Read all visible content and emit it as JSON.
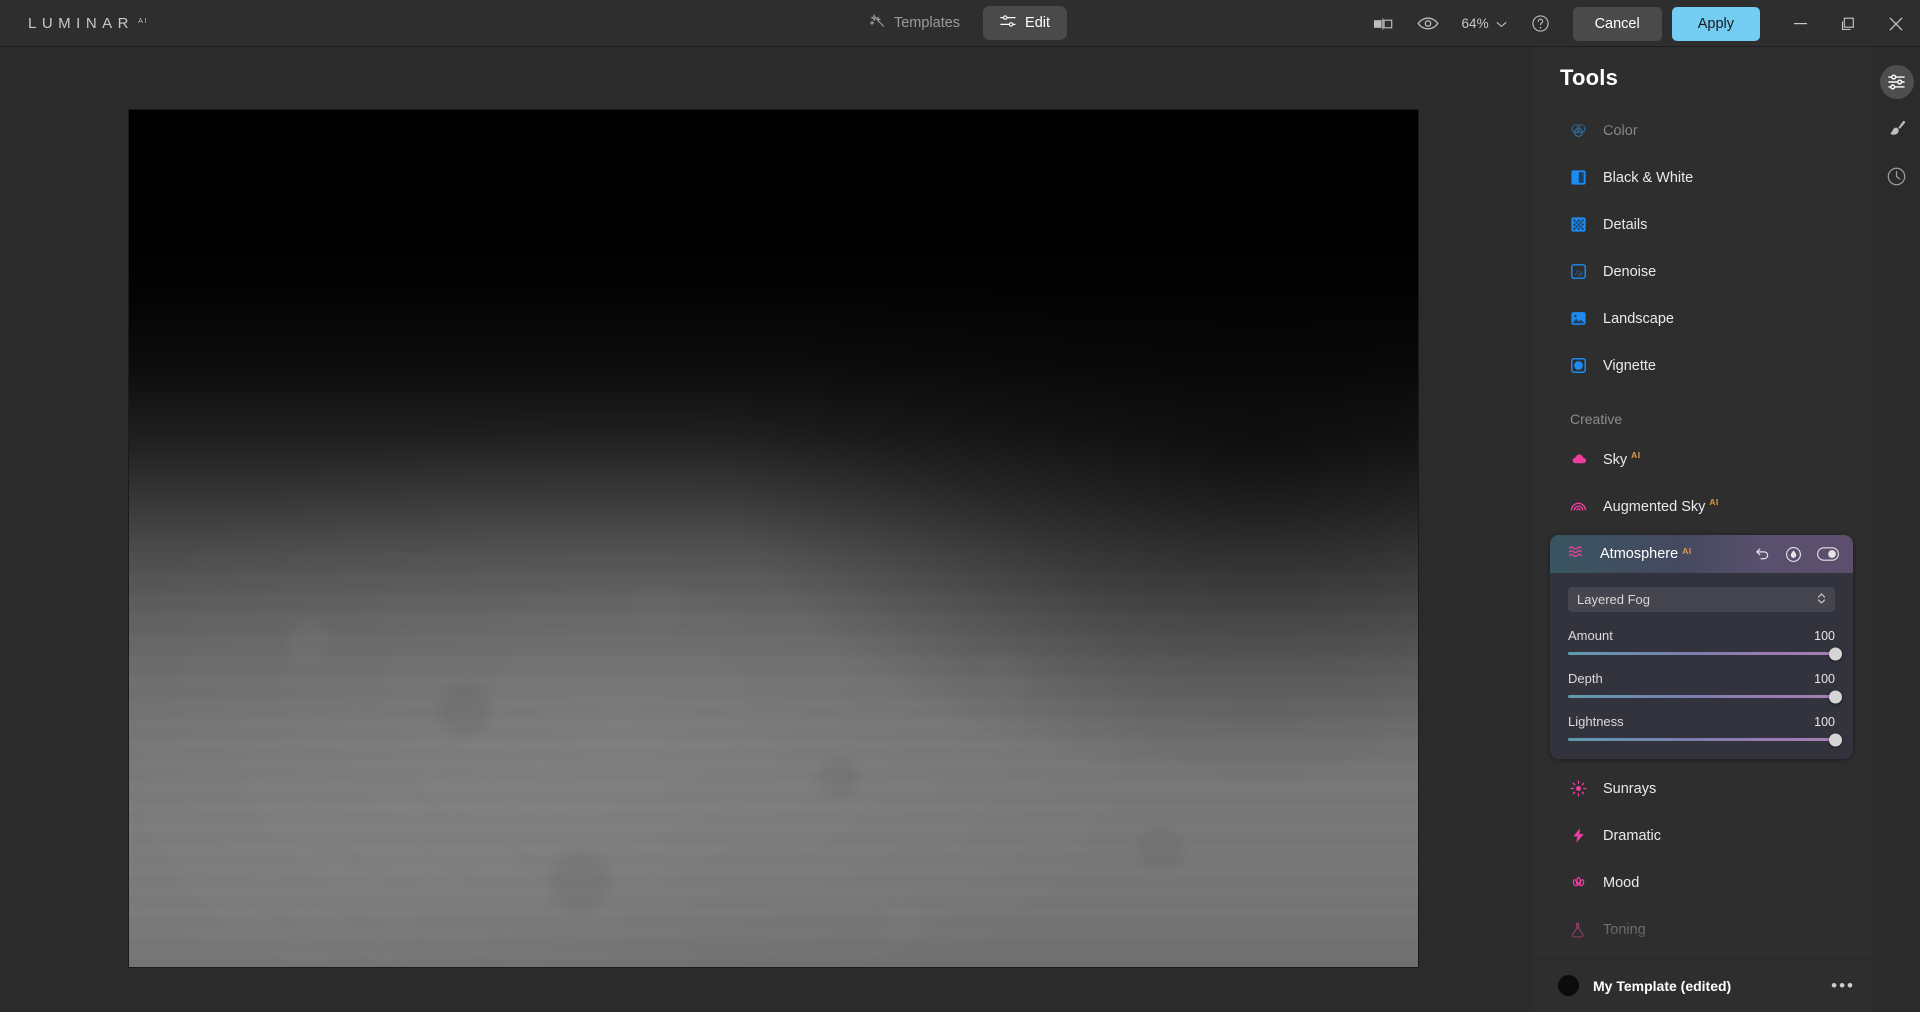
{
  "app": {
    "brand": "LUMINAR",
    "brand_sup": "AI",
    "accent_apply": "#73cdf2",
    "accent_tool_blue": "#1e8bf0",
    "accent_creative_pink": "#ef3ea0",
    "accent_ai_badge": "#e39a4a"
  },
  "header": {
    "templates_label": "Templates",
    "edit_label": "Edit",
    "zoom_level": "64%",
    "cancel_label": "Cancel",
    "apply_label": "Apply"
  },
  "tools": {
    "title": "Tools",
    "essentials": [
      {
        "label": "Color",
        "icon": "color-circles-icon",
        "state": "dimmed"
      },
      {
        "label": "Black & White",
        "icon": "black-white-icon",
        "state": "normal"
      },
      {
        "label": "Details",
        "icon": "details-grid-icon",
        "state": "normal"
      },
      {
        "label": "Denoise",
        "icon": "denoise-dots-icon",
        "state": "normal"
      },
      {
        "label": "Landscape",
        "icon": "landscape-photo-icon",
        "state": "normal"
      },
      {
        "label": "Vignette",
        "icon": "vignette-square-icon",
        "state": "normal"
      }
    ],
    "creative_section_label": "Creative",
    "creative_top": [
      {
        "label": "Sky",
        "badge": "AI",
        "icon": "cloud-icon"
      },
      {
        "label": "Augmented Sky",
        "badge": "AI",
        "icon": "rainbow-icon"
      }
    ],
    "creative_bottom": [
      {
        "label": "Sunrays",
        "badge": "",
        "icon": "sun-rays-icon",
        "state": "normal"
      },
      {
        "label": "Dramatic",
        "badge": "",
        "icon": "lightning-bolt-icon",
        "state": "normal"
      },
      {
        "label": "Mood",
        "badge": "",
        "icon": "lotus-icon",
        "state": "normal"
      },
      {
        "label": "Toning",
        "badge": "",
        "icon": "flask-icon",
        "state": "dimmed"
      }
    ]
  },
  "atmosphere": {
    "title": "Atmosphere",
    "badge": "AI",
    "reset_icon": "undo-arrow-icon",
    "mask_icon": "mask-brush-icon",
    "toggle_state": "on",
    "preset": {
      "value": "Layered Fog"
    },
    "sliders": [
      {
        "label": "Amount",
        "value": "100",
        "percent": 100
      },
      {
        "label": "Depth",
        "value": "100",
        "percent": 100
      },
      {
        "label": "Lightness",
        "value": "100",
        "percent": 100
      }
    ]
  },
  "template_bar": {
    "name": "My Template (edited)",
    "menu": "•••"
  },
  "rail": {
    "items": [
      {
        "icon": "adjustments-sliders-icon",
        "active": true
      },
      {
        "icon": "brush-icon",
        "active": false
      },
      {
        "icon": "history-clock-icon",
        "active": false
      }
    ]
  }
}
